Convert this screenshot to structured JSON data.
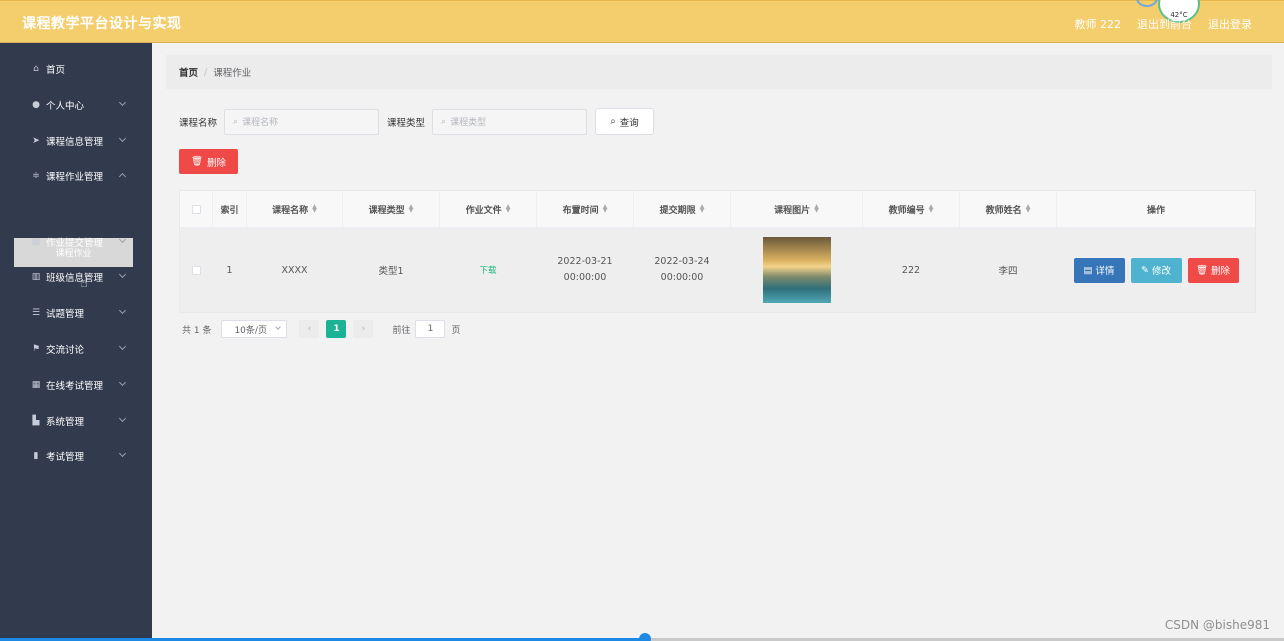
{
  "header": {
    "title": "课程教学平台设计与实现",
    "user_label": "教师 222",
    "exit_to_front": "退出到前台",
    "logout": "退出登录",
    "weather_temp": "42°C"
  },
  "sidebar": {
    "items": [
      {
        "label": "首页",
        "icon": "home-icon",
        "expandable": false
      },
      {
        "label": "个人中心",
        "icon": "user-icon",
        "expandable": true
      },
      {
        "label": "课程信息管理",
        "icon": "send-icon",
        "expandable": true
      },
      {
        "label": "课程作业管理",
        "icon": "sliders-icon",
        "expandable": true
      },
      {
        "label": "作业提交管理",
        "icon": "picture-icon",
        "expandable": true
      },
      {
        "label": "班级信息管理",
        "icon": "bank-icon",
        "expandable": true
      },
      {
        "label": "试题管理",
        "icon": "list-icon",
        "expandable": true
      },
      {
        "label": "交流讨论",
        "icon": "flag-icon",
        "expandable": true
      },
      {
        "label": "在线考试管理",
        "icon": "grid-icon",
        "expandable": true
      },
      {
        "label": "系统管理",
        "icon": "briefcase-icon",
        "expandable": true
      },
      {
        "label": "考试管理",
        "icon": "chart-icon",
        "expandable": true
      }
    ],
    "active_submenu": "课程作业"
  },
  "breadcrumb": {
    "home": "首页",
    "separator": "/",
    "current": "课程作业"
  },
  "search": {
    "course_name_label": "课程名称",
    "course_name_placeholder": "课程名称",
    "course_type_label": "课程类型",
    "course_type_placeholder": "课程类型",
    "query_button": "查询"
  },
  "toolbar": {
    "delete_button": "删除"
  },
  "table": {
    "headers": [
      "索引",
      "课程名称",
      "课程类型",
      "作业文件",
      "布置时间",
      "提交期限",
      "课程图片",
      "教师编号",
      "教师姓名",
      "操作"
    ],
    "rows": [
      {
        "index": "1",
        "course_name": "XXXX",
        "course_type": "类型1",
        "file": "下载",
        "assign_time": "2022-03-21 00:00:00",
        "deadline": "2022-03-24 00:00:00",
        "teacher_no": "222",
        "teacher_name": "李四",
        "actions": {
          "detail": "详情",
          "edit": "修改",
          "delete": "删除"
        }
      }
    ]
  },
  "pagination": {
    "total": "共 1 条",
    "page_size": "10条/页",
    "current_page": "1",
    "goto_label": "前往",
    "goto_value": "1",
    "page_suffix": "页"
  },
  "watermark": "CSDN @bishe981",
  "colors": {
    "header": "#f4cd6d",
    "sidebar": "#323a4d",
    "danger": "#f04a48",
    "primary": "#3575b8",
    "info": "#4fb3cf",
    "success": "#1bb394"
  }
}
